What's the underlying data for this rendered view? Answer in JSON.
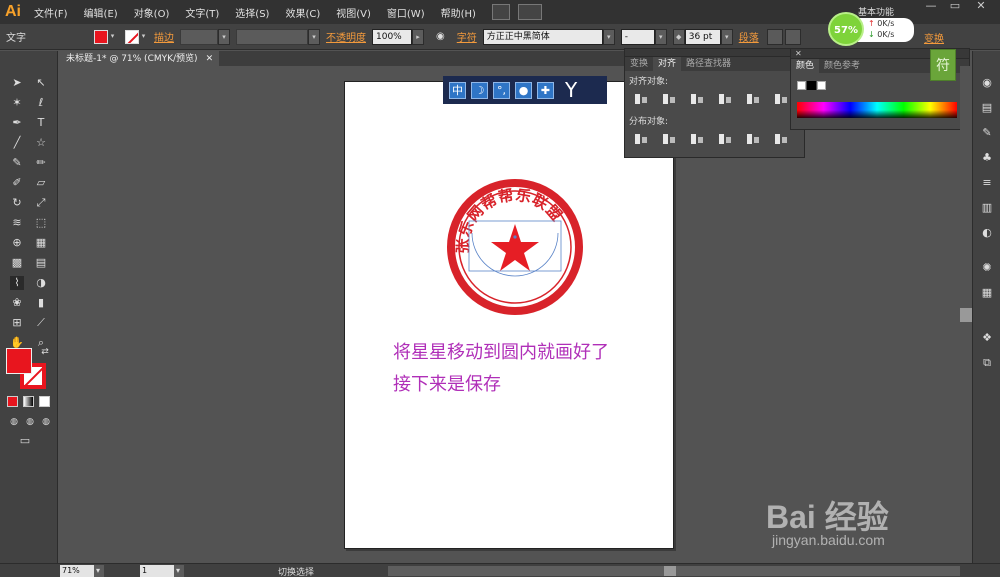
{
  "app": {
    "logo": "Ai",
    "workspace": "基本功能"
  },
  "menu": [
    "文件(F)",
    "编辑(E)",
    "对象(O)",
    "文字(T)",
    "选择(S)",
    "效果(C)",
    "视图(V)",
    "窗口(W)",
    "帮助(H)"
  ],
  "controlbar": {
    "selection_label": "文字",
    "stroke_label": "描边",
    "opacity_label": "不透明度",
    "opacity_value": "100%",
    "char_label": "字符",
    "font_family": "方正正中黑简体",
    "font_style": "-",
    "font_size": "36 pt",
    "para_label": "段落",
    "transform_label": "变换"
  },
  "document": {
    "tab": "未标题-1* @ 71% (CMYK/预览)"
  },
  "artboard": {
    "stamp_text": "张乐网帮帮乐联盟",
    "caption1": "将星星移动到圆内就画好了",
    "caption2": "接下来是保存",
    "stamp_color": "#d8232a",
    "caption_color": "#b02fb8"
  },
  "align_panel": {
    "tabs": [
      "变换",
      "对齐",
      "路径查找器"
    ],
    "align_objects": "对齐对象:",
    "distribute_objects": "分布对象:"
  },
  "color_panel": {
    "tabs": [
      "颜色",
      "颜色参考"
    ]
  },
  "float_toolbar": {
    "icons": [
      "中",
      "☽",
      "°,",
      "人",
      "扳手",
      "衣"
    ]
  },
  "net_widget": {
    "percent": "57%",
    "up": "0K/s",
    "down": "0K/s"
  },
  "status": {
    "zoom": "71%",
    "page": "1",
    "tool_hint": "切换选择"
  },
  "watermark": {
    "brand": "Bai 经验",
    "url": "jingyan.baidu.com"
  }
}
